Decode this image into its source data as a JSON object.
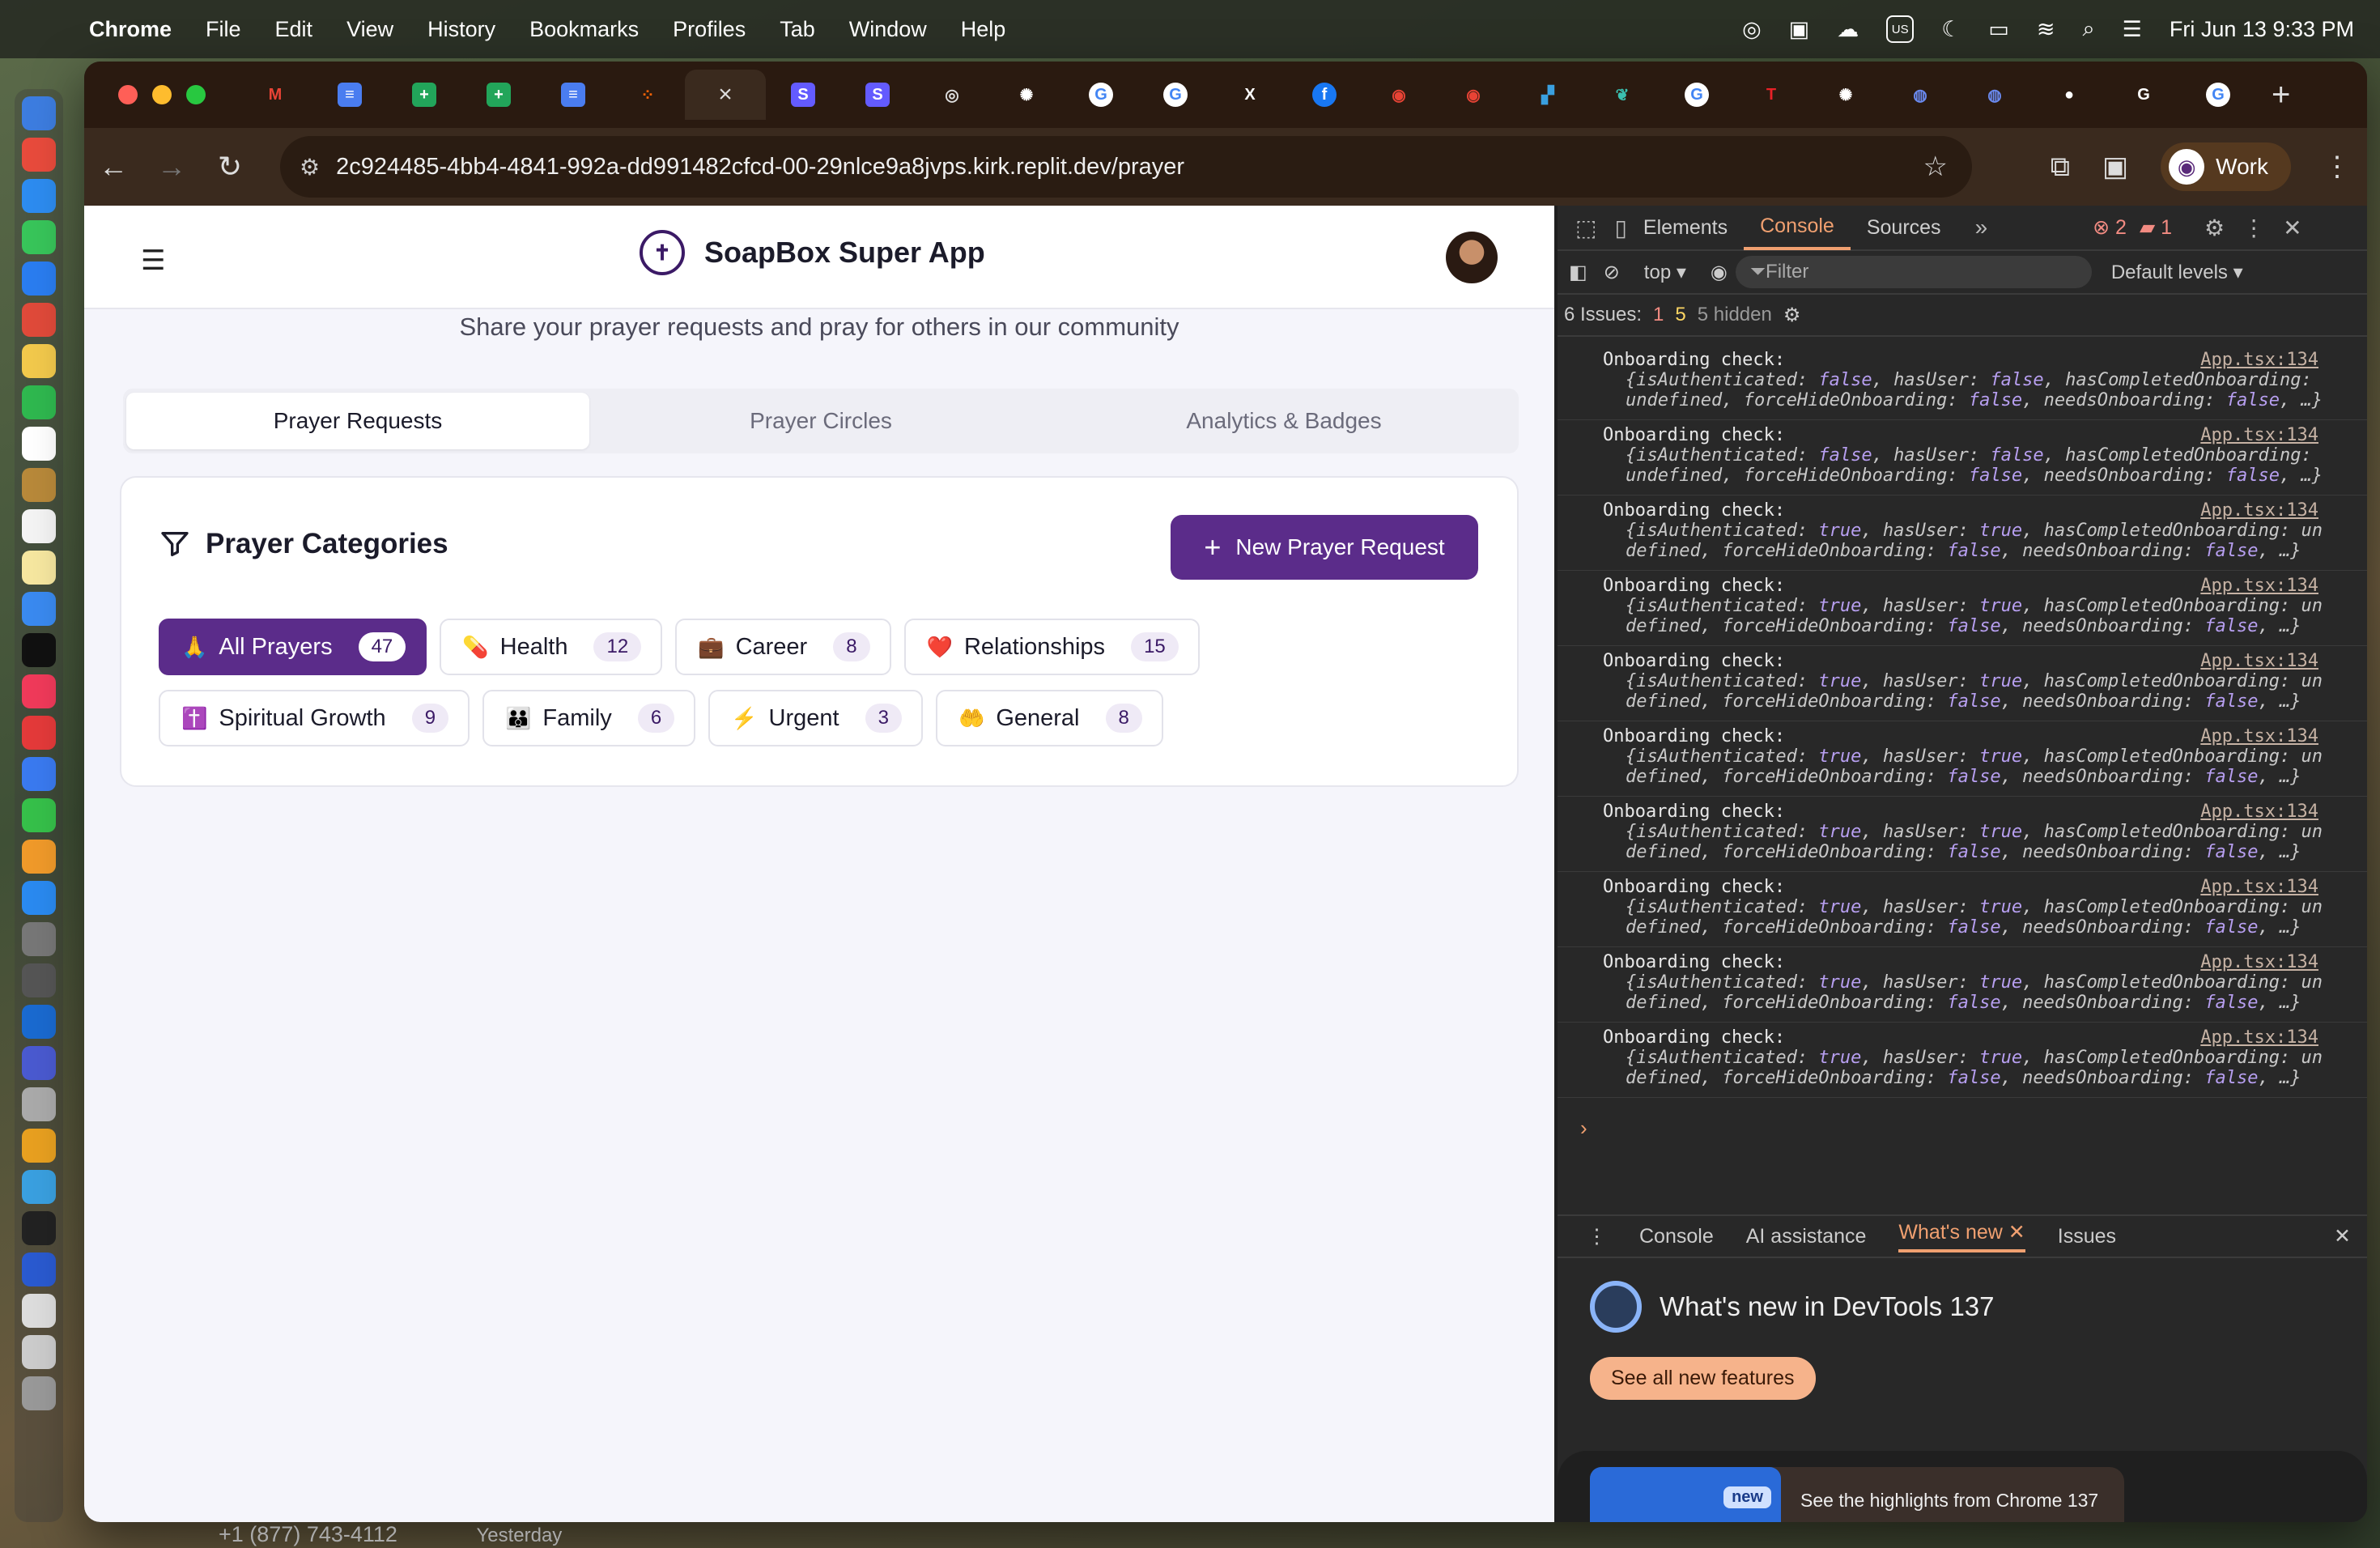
{
  "menubar": {
    "app": "Chrome",
    "items": [
      "File",
      "Edit",
      "View",
      "History",
      "Bookmarks",
      "Profiles",
      "Tab",
      "Window",
      "Help"
    ],
    "input_source": "US",
    "datetime": "Fri Jun 13  9:33 PM"
  },
  "browser": {
    "url": "2c924485-4bb4-4841-992a-dd991482cfcd-00-29nlce9a8jvps.kirk.replit.dev/prayer",
    "profile_label": "Work",
    "new_tab_symbol": "+"
  },
  "app": {
    "title": "SoapBox Super App",
    "subtitle": "Share your prayer requests and pray for others in our community",
    "tabs": [
      "Prayer Requests",
      "Prayer Circles",
      "Analytics & Badges"
    ],
    "section_title": "Prayer Categories",
    "new_button": "New Prayer Request",
    "categories_row1": [
      {
        "emoji": "🙏",
        "label": "All Prayers",
        "count": "47"
      },
      {
        "emoji": "💊",
        "label": "Health",
        "count": "12"
      },
      {
        "emoji": "💼",
        "label": "Career",
        "count": "8"
      },
      {
        "emoji": "❤️",
        "label": "Relationships",
        "count": "15"
      }
    ],
    "categories_row2": [
      {
        "emoji": "✝️",
        "label": "Spiritual Growth",
        "count": "9"
      },
      {
        "emoji": "👪",
        "label": "Family",
        "count": "6"
      },
      {
        "emoji": "⚡",
        "label": "Urgent",
        "count": "3"
      },
      {
        "emoji": "🤲",
        "label": "General",
        "count": "8"
      }
    ]
  },
  "devtools": {
    "tabs": [
      "Elements",
      "Console",
      "Sources"
    ],
    "error_count": "2",
    "warn_count": "1",
    "context": "top",
    "filter_placeholder": "Filter",
    "levels": "Default levels",
    "issues_label": "6 Issues:",
    "issues_err": "1",
    "issues_info": "5",
    "hidden": "5 hidden",
    "entries": [
      {
        "msg": "Onboarding check:",
        "src": "App.tsx:134",
        "l2": "{isAuthenticated: false, hasUser: false, hasCompletedOnboarding:",
        "l3": "undefined, forceHideOnboarding: false, needsOnboarding: false, …}"
      },
      {
        "msg": "Onboarding check:",
        "src": "App.tsx:134",
        "l2": "{isAuthenticated: false, hasUser: false, hasCompletedOnboarding:",
        "l3": "undefined, forceHideOnboarding: false, needsOnboarding: false, …}"
      },
      {
        "msg": "Onboarding check:",
        "src": "App.tsx:134",
        "l2": "{isAuthenticated: true, hasUser: true, hasCompletedOnboarding: un",
        "l3": "defined, forceHideOnboarding: false, needsOnboarding: false, …}"
      },
      {
        "msg": "Onboarding check:",
        "src": "App.tsx:134",
        "l2": "{isAuthenticated: true, hasUser: true, hasCompletedOnboarding: un",
        "l3": "defined, forceHideOnboarding: false, needsOnboarding: false, …}"
      },
      {
        "msg": "Onboarding check:",
        "src": "App.tsx:134",
        "l2": "{isAuthenticated: true, hasUser: true, hasCompletedOnboarding: un",
        "l3": "defined, forceHideOnboarding: false, needsOnboarding: false, …}"
      },
      {
        "msg": "Onboarding check:",
        "src": "App.tsx:134",
        "l2": "{isAuthenticated: true, hasUser: true, hasCompletedOnboarding: un",
        "l3": "defined, forceHideOnboarding: false, needsOnboarding: false, …}"
      },
      {
        "msg": "Onboarding check:",
        "src": "App.tsx:134",
        "l2": "{isAuthenticated: true, hasUser: true, hasCompletedOnboarding: un",
        "l3": "defined, forceHideOnboarding: false, needsOnboarding: false, …}"
      },
      {
        "msg": "Onboarding check:",
        "src": "App.tsx:134",
        "l2": "{isAuthenticated: true, hasUser: true, hasCompletedOnboarding: un",
        "l3": "defined, forceHideOnboarding: false, needsOnboarding: false, …}"
      },
      {
        "msg": "Onboarding check:",
        "src": "App.tsx:134",
        "l2": "{isAuthenticated: true, hasUser: true, hasCompletedOnboarding: un",
        "l3": "defined, forceHideOnboarding: false, needsOnboarding: false, …}"
      },
      {
        "msg": "Onboarding check:",
        "src": "App.tsx:134",
        "l2": "{isAuthenticated: true, hasUser: true, hasCompletedOnboarding: un",
        "l3": "defined, forceHideOnboarding: false, needsOnboarding: false, …}"
      }
    ],
    "drawer_tabs": [
      "Console",
      "AI assistance",
      "What's new",
      "Issues"
    ],
    "whatsnew_title": "What's new in DevTools 137",
    "see_all": "See all new features",
    "new_badge": "new",
    "highlight": "See the highlights from Chrome 137"
  },
  "background_app": {
    "phone": "+1 (877) 743-4112",
    "when": "Yesterday"
  },
  "colors": {
    "accent": "#5b2c8a",
    "devtools_accent": "#f0a070"
  }
}
